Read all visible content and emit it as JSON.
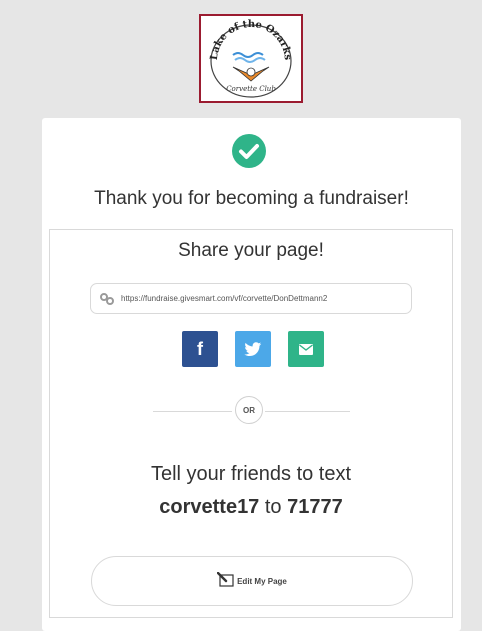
{
  "logo": {
    "top_text": "Lake of the Ozarks",
    "bottom_text": "Corvette Club",
    "border_color": "#9b1b30"
  },
  "card": {
    "check_icon": "check-circle-icon",
    "check_color": "#2fb489",
    "title": "Thank you for becoming a fundraiser!"
  },
  "share": {
    "title": "Share your page!",
    "url_icon": "link-icon",
    "url": "https://fundraise.givesmart.com/vf/corvette/DonDettmann2",
    "buttons": [
      {
        "name": "facebook",
        "icon": "facebook-icon",
        "glyph": "f",
        "color": "#2d5191"
      },
      {
        "name": "twitter",
        "icon": "twitter-icon",
        "color": "#4ca8e8"
      },
      {
        "name": "email",
        "icon": "email-icon",
        "color": "#2fb489"
      }
    ],
    "or_label": "OR"
  },
  "text_to_give": {
    "line1": "Tell your friends to text",
    "keyword": "corvette17",
    "connector": " to ",
    "number": "71777"
  },
  "edit": {
    "icon": "edit-icon",
    "label": "Edit My Page"
  }
}
